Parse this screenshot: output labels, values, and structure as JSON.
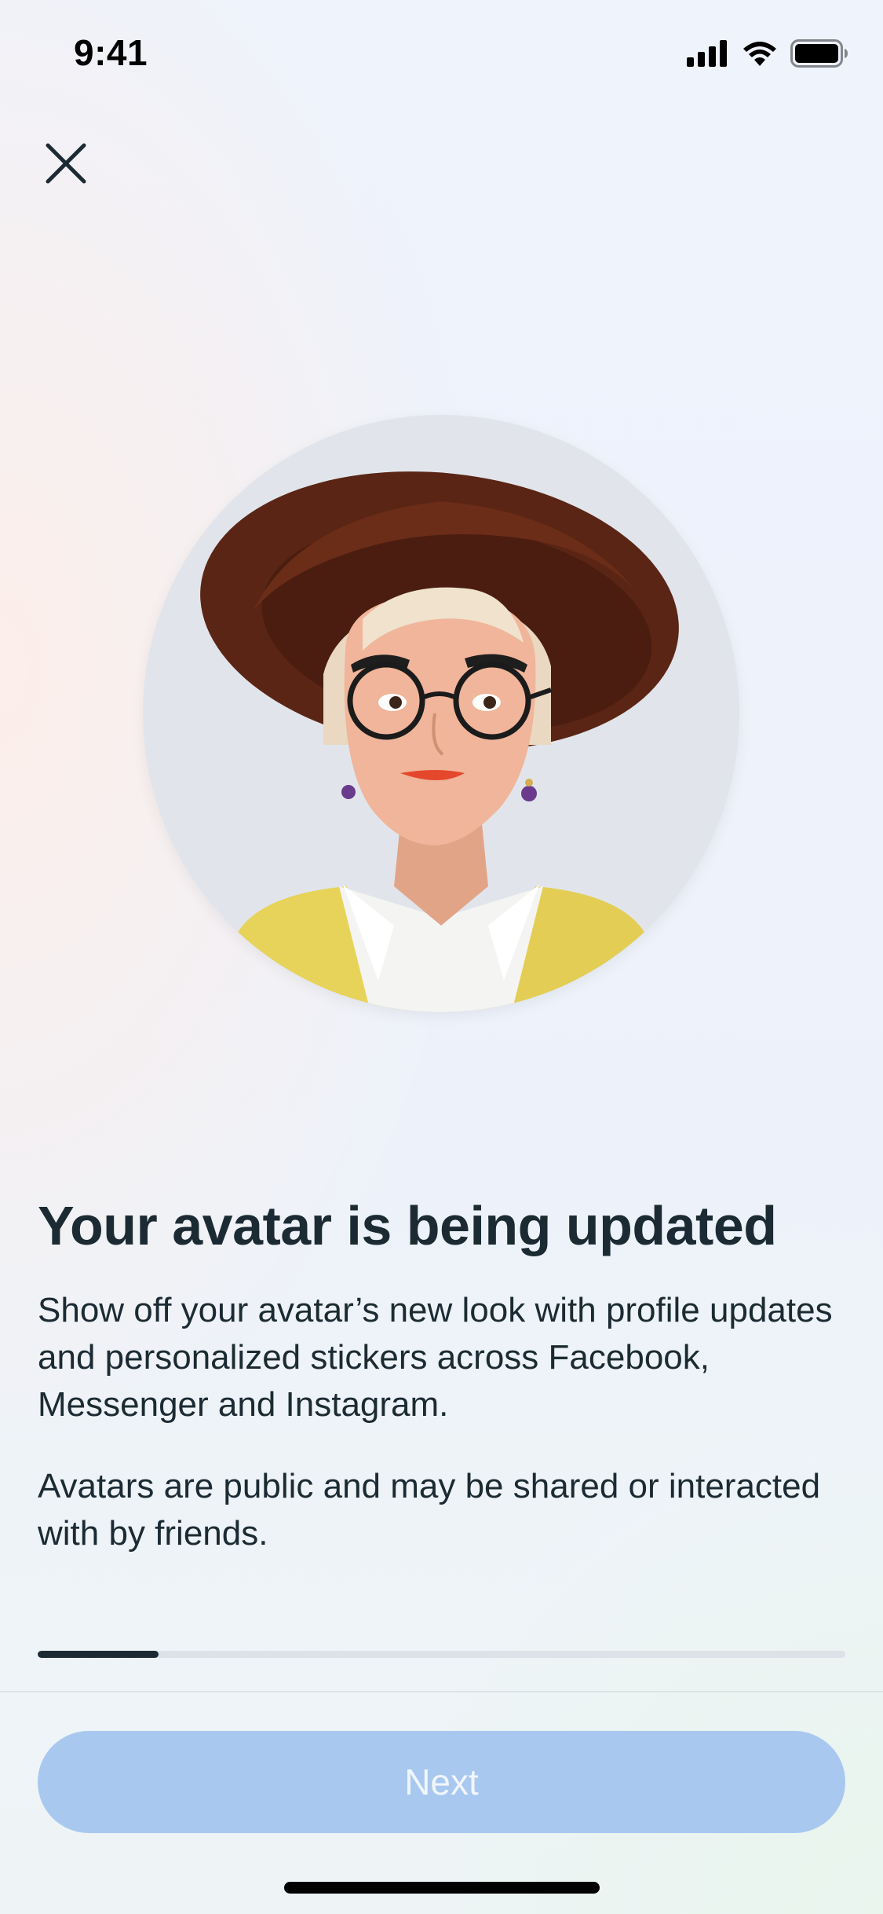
{
  "status_bar": {
    "time": "9:41",
    "icons": [
      "cellular-signal-icon",
      "wifi-icon",
      "battery-icon"
    ]
  },
  "header": {
    "close_icon": "close-icon"
  },
  "avatar": {
    "image": "3d-avatar-portrait",
    "description_visible": false
  },
  "content": {
    "title": "Your avatar is being updated",
    "paragraph_1": "Show off your avatar’s new look with profile updates and personalized stickers across Facebook, Messenger and Instagram.",
    "paragraph_2": "Avatars are public and may be shared or interacted with by friends."
  },
  "progress": {
    "fraction": 0.15
  },
  "footer": {
    "next_label": "Next",
    "next_enabled": false
  },
  "colors": {
    "text": "#1c2b33",
    "button_disabled": "#a8c8ef",
    "progress_fill": "#1c2b33",
    "progress_track": "#dde2e8",
    "avatar_bg": "#e1e5eb"
  }
}
